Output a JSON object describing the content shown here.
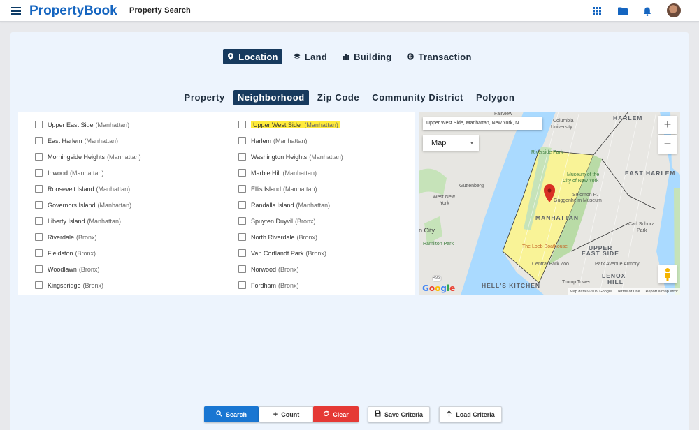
{
  "header": {
    "brand": "PropertyBook",
    "subtitle": "Property Search"
  },
  "category_tabs": [
    {
      "label": "Location",
      "icon": "map-pin-icon",
      "active": true
    },
    {
      "label": "Land",
      "icon": "layers-icon",
      "active": false
    },
    {
      "label": "Building",
      "icon": "building-icon",
      "active": false
    },
    {
      "label": "Transaction",
      "icon": "dollar-icon",
      "active": false
    }
  ],
  "location_tabs": [
    {
      "label": "Property",
      "active": false
    },
    {
      "label": "Neighborhood",
      "active": true
    },
    {
      "label": "Zip Code",
      "active": false
    },
    {
      "label": "Community District",
      "active": false
    },
    {
      "label": "Polygon",
      "active": false
    }
  ],
  "neighborhoods": {
    "left": [
      {
        "name": "Upper East Side",
        "borough": "(Manhattan)"
      },
      {
        "name": "East Harlem",
        "borough": "(Manhattan)"
      },
      {
        "name": "Morningside Heights",
        "borough": "(Manhattan)"
      },
      {
        "name": "Inwood",
        "borough": "(Manhattan)"
      },
      {
        "name": "Roosevelt Island",
        "borough": "(Manhattan)"
      },
      {
        "name": "Governors Island",
        "borough": "(Manhattan)"
      },
      {
        "name": "Liberty Island",
        "borough": "(Manhattan)"
      },
      {
        "name": "Riverdale",
        "borough": "(Bronx)"
      },
      {
        "name": "Fieldston",
        "borough": "(Bronx)"
      },
      {
        "name": "Woodlawn",
        "borough": "(Bronx)"
      },
      {
        "name": "Kingsbridge",
        "borough": "(Bronx)"
      }
    ],
    "right": [
      {
        "name": "Upper West Side",
        "borough": "(Manhattan)",
        "highlighted": true
      },
      {
        "name": "Harlem",
        "borough": "(Manhattan)"
      },
      {
        "name": "Washington Heights",
        "borough": "(Manhattan)"
      },
      {
        "name": "Marble Hill",
        "borough": "(Manhattan)"
      },
      {
        "name": "Ellis Island",
        "borough": "(Manhattan)"
      },
      {
        "name": "Randalls Island",
        "borough": "(Manhattan)"
      },
      {
        "name": "Spuyten Duyvil",
        "borough": "(Bronx)"
      },
      {
        "name": "North Riverdale",
        "borough": "(Bronx)"
      },
      {
        "name": "Van Cortlandt Park",
        "borough": "(Bronx)"
      },
      {
        "name": "Norwood",
        "borough": "(Bronx)"
      },
      {
        "name": "Fordham",
        "borough": "(Bronx)"
      }
    ]
  },
  "map": {
    "address": "Upper West Side, Manhattan, New York, N...",
    "map_type": "Map",
    "zoom_in": "+",
    "zoom_out": "−",
    "attribution": [
      "Map data ©2019 Google",
      "Terms of Use",
      "Report a map error"
    ],
    "logo": "Google",
    "labels": {
      "fairview": "Fairview",
      "columbia": "Columbia",
      "university": "University",
      "harlem": "HARLEM",
      "riverside_park": "Riverside Park",
      "museum1": "Museum of the",
      "museum2": "City of New York",
      "east_harlem": "EAST HARLEM",
      "guttenberg": "Guttenberg",
      "solomon": "Solomon R.",
      "guggenheim": "Guggenheim Museum",
      "west_new": "West New",
      "york": "York",
      "manhattan": "MANHATTAN",
      "city": "n City",
      "hamilton_park": "Hamilton Park",
      "carl_schurz": "Carl Schurz",
      "park": "Park",
      "loeb": "The Loeb Boathouse",
      "upper": "UPPER",
      "east_side": "EAST SIDE",
      "central_park_zoo": "Central Park Zoo",
      "park_ave_armory": "Park Avenue Armory",
      "lenox": "LENOX",
      "hill": "HILL",
      "trump_tower": "Trump Tower",
      "hells_kitchen": "HELL'S KITCHEN",
      "route": "495"
    }
  },
  "actions": {
    "search": "Search",
    "count": "Count",
    "clear": "Clear",
    "save": "Save Criteria",
    "load": "Load Criteria"
  },
  "colors": {
    "brand": "#1565c0",
    "tab_active": "#173a5e",
    "search_button": "#1976d2",
    "clear_button": "#e53935",
    "highlight": "#ffeb3b",
    "panel_background": "#edf4fd"
  }
}
